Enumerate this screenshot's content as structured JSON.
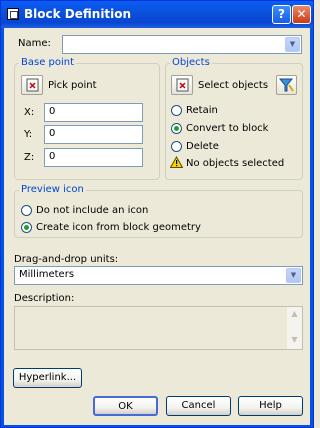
{
  "window": {
    "title": "Block Definition"
  },
  "name": {
    "label": "Name:",
    "value": ""
  },
  "base_point": {
    "title": "Base point",
    "pick_label": "Pick point",
    "x_label": "X:",
    "x_value": "0",
    "y_label": "Y:",
    "y_value": "0",
    "z_label": "Z:",
    "z_value": "0"
  },
  "objects": {
    "title": "Objects",
    "select_label": "Select objects",
    "retain_label": "Retain",
    "convert_label": "Convert to block",
    "delete_label": "Delete",
    "status": "No objects selected",
    "selected_option": "convert"
  },
  "preview": {
    "title": "Preview icon",
    "none_label": "Do not include an icon",
    "create_label": "Create icon from block geometry",
    "selected_option": "create"
  },
  "units": {
    "label": "Drag-and-drop units:",
    "value": "Millimeters"
  },
  "description": {
    "label": "Description:",
    "value": ""
  },
  "buttons": {
    "hyperlink": "Hyperlink...",
    "ok": "OK",
    "cancel": "Cancel",
    "help": "Help"
  }
}
